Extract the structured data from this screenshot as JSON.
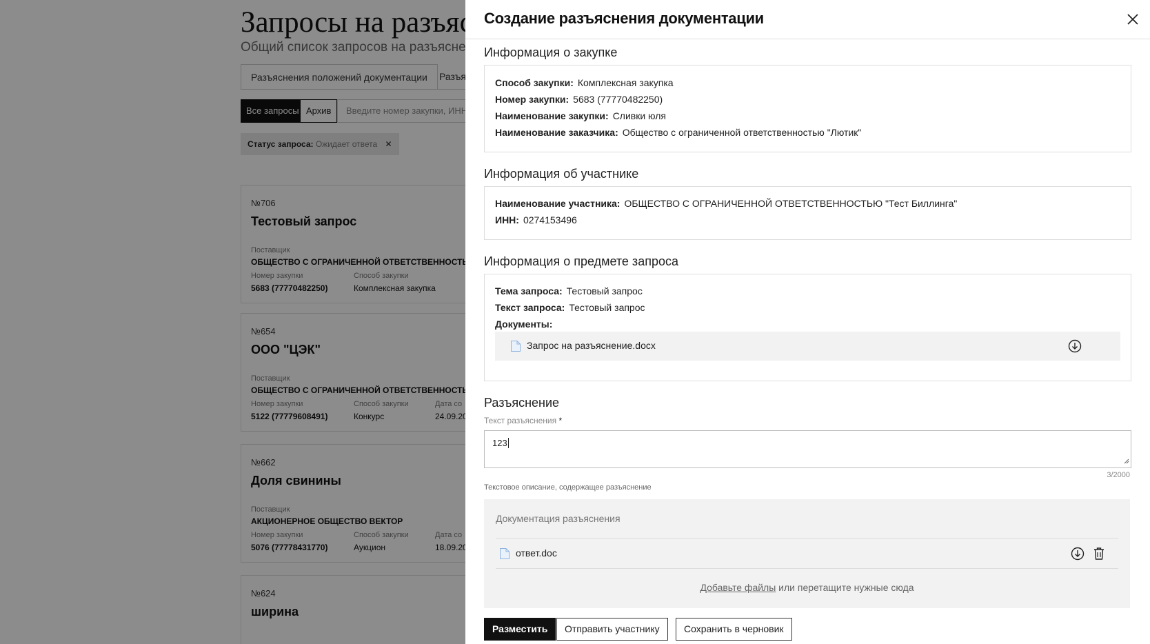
{
  "background": {
    "title": "Запросы на разъясн",
    "subtitle": "Общий список запросов на разъяснение",
    "tabs": [
      "Разъяснения положений документации",
      "Разъя"
    ],
    "filter": {
      "all": "Все запросы",
      "archive": "Архив"
    },
    "search_placeholder": "Введите номер закупки, ИНН п",
    "chip": {
      "label": "Статус запроса:",
      "value": "Ожидает ответа",
      "close": "✕"
    },
    "cards": [
      {
        "num": "№706",
        "title": "Тестовый запрос",
        "supplier_label": "Поставщик",
        "supplier": "ОБЩЕСТВО С ОГРАНИЧЕННОЙ ОТВЕТСТВЕННОСТЬЮ \"ТЕСТ",
        "pnum_label": "Номер закупки",
        "pnum": "5683 (77770482250)",
        "method_label": "Способ закупки",
        "method": "Комплексная закупка",
        "date_label": "",
        "date": ""
      },
      {
        "num": "№654",
        "title": "ООО \"ЦЭК\"",
        "supplier_label": "Поставщик",
        "supplier": "ОБЩЕСТВО С ОГРАНИЧЕННОЙ ОТВЕТСТВЕННОСТЬЮ \"ТЕСТ",
        "pnum_label": "Номер закупки",
        "pnum": "5122 (77779608491)",
        "method_label": "Способ закупки",
        "method": "Конкурс",
        "date_label": "Дата со",
        "date": "24.09.20"
      },
      {
        "num": "№662",
        "title": "Доля свинины",
        "supplier_label": "Поставщик",
        "supplier": "АКЦИОНЕРНОЕ ОБЩЕСТВО ВЕКТОР",
        "pnum_label": "Номер закупки",
        "pnum": "5076 (77778431770)",
        "method_label": "Способ закупки",
        "method": "Аукцион",
        "date_label": "Дата со",
        "date": "18.09.20"
      },
      {
        "num": "№624",
        "title": "ширина"
      }
    ]
  },
  "drawer": {
    "title": "Создание разъяснения документации",
    "purchase": {
      "heading": "Информация о закупке",
      "method_label": "Способ закупки:",
      "method": "Комплексная закупка",
      "number_label": "Номер закупки:",
      "number": "5683 (77770482250)",
      "name_label": "Наименование закупки:",
      "name": "Сливки юля",
      "customer_label": "Наименование заказчика:",
      "customer": "Общество с ограниченной ответственностью \"Лютик\""
    },
    "participant": {
      "heading": "Информация об участнике",
      "name_label": "Наименование участника:",
      "name": "ОБЩЕСТВО С ОГРАНИЧЕННОЙ ОТВЕТСТВЕННОСТЬЮ \"Тест Биллинга\"",
      "inn_label": "ИНН:",
      "inn": "0274153496"
    },
    "subject": {
      "heading": "Информация о предмете запроса",
      "topic_label": "Тема запроса:",
      "topic": "Тестовый запрос",
      "text_label": "Текст запроса:",
      "text": "Тестовый запрос",
      "docs_label": "Документы:",
      "file": "Запрос на разъяснение.docx"
    },
    "clarification": {
      "heading": "Разъяснение",
      "field_label": "Текст разъяснения",
      "required_mark": "*",
      "value": "123",
      "counter": "3/2000",
      "hint": "Текстовое описание, содержащее разъяснение",
      "docs_heading": "Документация разъяснения",
      "file": "ответ.doc",
      "upload_link": "Добавьте файлы",
      "upload_rest": " или перетащите нужные сюда"
    },
    "buttons": {
      "publish": "Разместить",
      "send": "Отправить участнику",
      "draft": "Сохранить в черновик"
    }
  },
  "colors": {
    "overlay": "rgba(0,0,0,0.45)",
    "primary_button": "#111111",
    "file_row_bg": "#f2f2f2"
  },
  "icons": [
    "close-icon",
    "document-icon",
    "download-icon",
    "trash-icon",
    "resize-grip-icon"
  ]
}
